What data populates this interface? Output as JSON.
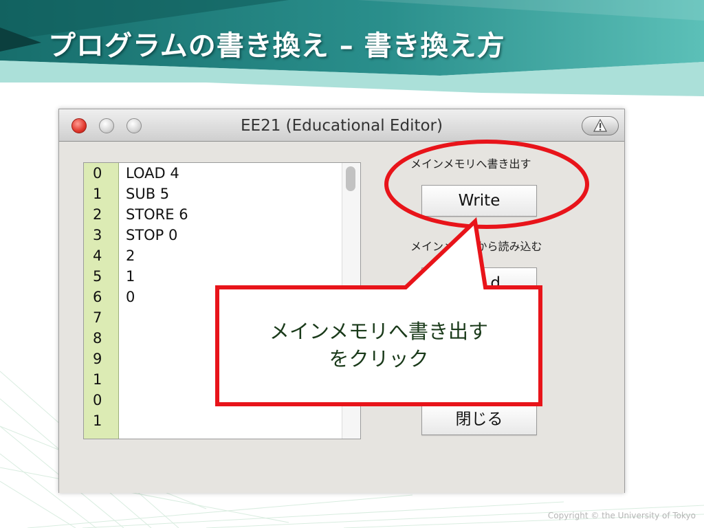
{
  "slide": {
    "title": "プログラムの書き換え – 書き換え方",
    "footer": "Copyright © the University of Tokyo"
  },
  "window": {
    "title": "EE21 (Educational Editor)",
    "buttons": [
      "close",
      "minimize",
      "zoom"
    ],
    "toolbar_icon": "warning-icon"
  },
  "editor": {
    "line_numbers": [
      "0",
      "1",
      "2",
      "3",
      "4",
      "5",
      "6",
      "7",
      "8",
      "9",
      "1",
      "0",
      "1"
    ],
    "lines": [
      "LOAD 4",
      "SUB 5",
      "STORE 6",
      "STOP 0",
      "2",
      "1",
      "0"
    ]
  },
  "panel": {
    "write_label": "メインメモリへ書き出す",
    "write_button": "Write",
    "read_label": "メインメモリから読み込む",
    "read_button_visible_text": "d",
    "close_button": "閉じる"
  },
  "callout": {
    "line1": "メインメモリへ書き出す",
    "line2": "をクリック",
    "color": "#e8141a"
  },
  "colors": {
    "title_band": "#1f7f80",
    "gutter": "#dcebb4",
    "highlight": "#e8141a"
  }
}
